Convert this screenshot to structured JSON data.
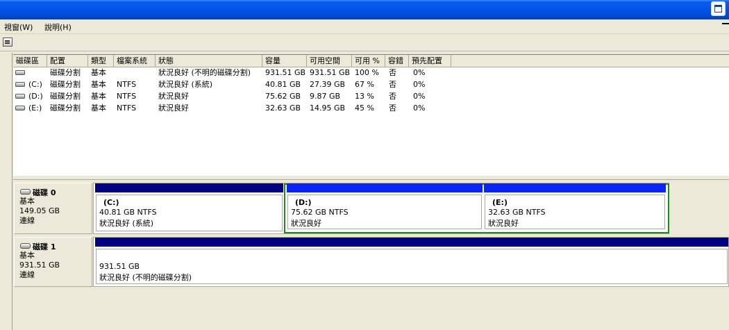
{
  "colors": {
    "primary_bar": "#000080",
    "logical_bar": "#0a24f8",
    "extended_border": "#1a8a1a"
  },
  "menu": {
    "items": [
      {
        "label": "視窗(W)"
      },
      {
        "label": "說明(H)"
      }
    ]
  },
  "toolbar": {
    "icon": "disk-properties-icon"
  },
  "volume_list": {
    "columns": [
      "磁碟區",
      "配置",
      "類型",
      "檔案系統",
      "狀態",
      "容量",
      "可用空間",
      "可用 %",
      "容錯",
      "預先配置"
    ],
    "rows": [
      {
        "volume": "",
        "layout": "磁碟分割",
        "type": "基本",
        "fs": "",
        "status": "狀況良好 (不明的磁碟分割)",
        "capacity": "931.51 GB",
        "free": "931.51 GB",
        "pct": "100 %",
        "fault": "否",
        "overhead": "0%"
      },
      {
        "volume": "(C:)",
        "layout": "磁碟分割",
        "type": "基本",
        "fs": "NTFS",
        "status": "狀況良好 (系統)",
        "capacity": "40.81 GB",
        "free": "27.39 GB",
        "pct": "67 %",
        "fault": "否",
        "overhead": "0%"
      },
      {
        "volume": "(D:)",
        "layout": "磁碟分割",
        "type": "基本",
        "fs": "NTFS",
        "status": "狀況良好",
        "capacity": "75.62 GB",
        "free": "9.87 GB",
        "pct": "13 %",
        "fault": "否",
        "overhead": "0%"
      },
      {
        "volume": "(E:)",
        "layout": "磁碟分割",
        "type": "基本",
        "fs": "NTFS",
        "status": "狀況良好",
        "capacity": "32.63 GB",
        "free": "14.95 GB",
        "pct": "45 %",
        "fault": "否",
        "overhead": "0%"
      }
    ]
  },
  "disks": [
    {
      "name": "磁碟 0",
      "type": "基本",
      "size": "149.05 GB",
      "state": "連線",
      "volumes": [
        {
          "title": "(C:)",
          "info": "40.81 GB NTFS",
          "status": "狀況良好 (系統)"
        },
        {
          "title": "(D:)",
          "info": "75.62 GB NTFS",
          "status": "狀況良好"
        },
        {
          "title": "(E:)",
          "info": "32.63 GB NTFS",
          "status": "狀況良好"
        }
      ]
    },
    {
      "name": "磁碟 1",
      "type": "基本",
      "size": "931.51 GB",
      "state": "連線",
      "volumes": [
        {
          "title": "",
          "info": "931.51 GB",
          "status": "狀況良好 (不明的磁碟分割)"
        }
      ]
    }
  ]
}
